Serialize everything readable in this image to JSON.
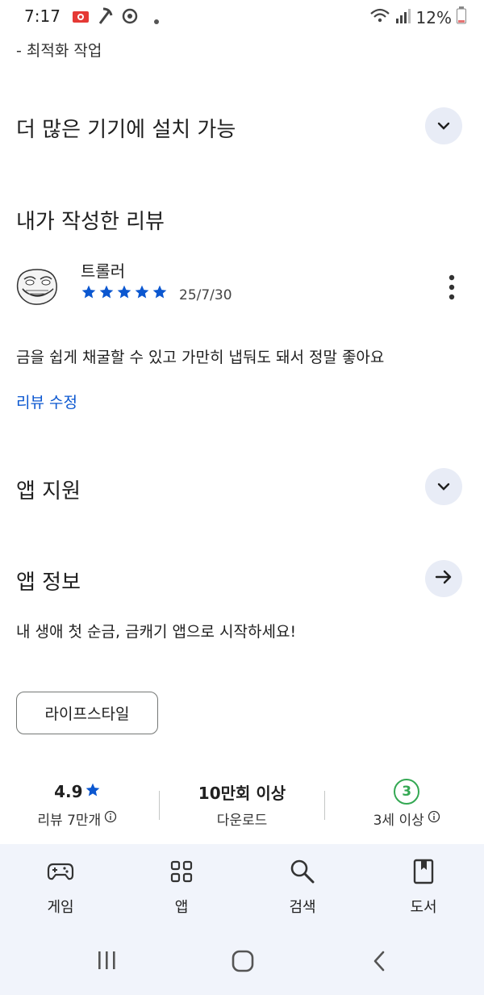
{
  "status": {
    "time": "7:17",
    "battery": "12%"
  },
  "top_note": "- 최적화 작업",
  "install_section": {
    "title": "더 많은 기기에 설치 가능",
    "icon": "chevron-down-icon"
  },
  "my_review": {
    "title": "내가 작성한 리뷰",
    "reviewer": "트롤러",
    "rating_stars": 5,
    "date": "25/7/30",
    "text": "금을 쉽게 채굴할 수 있고 가만히 냅둬도 돼서 정말 좋아요",
    "edit_label": "리뷰 수정",
    "star_color": "#0b57d0"
  },
  "support_section": {
    "title": "앱 지원",
    "icon": "chevron-down-icon"
  },
  "about_section": {
    "title": "앱 정보",
    "icon": "arrow-right-icon",
    "description": "내 생애 첫 순금, 금캐기 앱으로 시작하세요!",
    "category_chip": "라이프스타일"
  },
  "stats": {
    "rating": "4.9",
    "reviews_label": "리뷰 7만개",
    "downloads": "10만회 이상",
    "downloads_label": "다운로드",
    "age_badge": "3",
    "age_label": "3세 이상",
    "age_color": "#34a853"
  },
  "bottom_nav": [
    {
      "label": "게임",
      "icon": "gamepad-icon"
    },
    {
      "label": "앱",
      "icon": "apps-grid-icon"
    },
    {
      "label": "검색",
      "icon": "search-icon"
    },
    {
      "label": "도서",
      "icon": "book-icon"
    }
  ]
}
